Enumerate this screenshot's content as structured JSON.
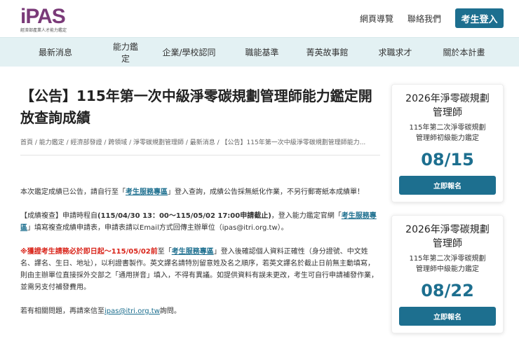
{
  "header": {
    "logo_text": "iPAS",
    "logo_sub": "經濟部產業人才能力鑑定",
    "links": [
      "網頁導覽",
      "聯絡我們"
    ],
    "login_label": "考生登入"
  },
  "nav": [
    "最新消息",
    "能力鑑定",
    "企業/學校認同",
    "職能基準",
    "菁英故事館",
    "求職求才",
    "關於本計畫"
  ],
  "article": {
    "title": "【公告】115年第一次中級淨零碳規劃管理師能力鑑定開放查詢成績",
    "breadcrumb": "首頁 / 能力鑑定 / 經濟部發證 / 跨領域 / 淨零碳規劃管理師 / 最新消息 / 【公告】115年第一次中級淨零碳規劃管理師能力...",
    "p1_a": "本次鑑定成績已公告，請自行至「",
    "p1_link": "考生服務專區",
    "p1_b": "」登入查詢，成績公告採無紙化作業，不另行郵寄紙本成績單！",
    "p2_a": "【成績複查】申請時程自",
    "p2_bold": "(115/04/30 13：00～115/05/02 17:00申請截止)",
    "p2_b": "，登入能力鑑定官網「",
    "p2_link": "考生服務專區",
    "p2_c": "」填寫複查成績申請表，申請表請以Email方式回傳主辦單位（ipas@itri.org.tw）。",
    "p3_red": "※獲證考生請務必於即日起～115/05/02前",
    "p3_a": "至「",
    "p3_link": "考生服務專區",
    "p3_b": "」登入後確認個人資料正確性（身分證號、中文姓名、譯名、生日、地址），以利證書製作。英文譯名請特別留意姓及名之順序，若英文譯名於截止日前無主動填寫，則由主辦單位直接採外交部之「通用拼音」填入，不得有異議。如提供資料有誤未更改，考生可自行申請補發作業，並需另支付補發費用。",
    "p4_a": "若有相關問題，再請來信至",
    "p4_link": "ipas@itri.org.tw",
    "p4_b": "詢問。"
  },
  "side": [
    {
      "title": "2026年淨零碳規劃管理師",
      "sub": "115年第二次淨零碳規劃管理師初級能力鑑定",
      "date": "08/15",
      "button": "立即報名"
    },
    {
      "title": "2026年淨零碳規劃管理師",
      "sub": "115年第二次淨零碳規劃管理師中級能力鑑定",
      "date": "08/22",
      "button": "立即報名"
    }
  ],
  "colors": {
    "brand": "#1d6f8f",
    "logo": "#7a3a78",
    "nav_bg": "#e3f1f3",
    "alert": "#d9241a"
  }
}
